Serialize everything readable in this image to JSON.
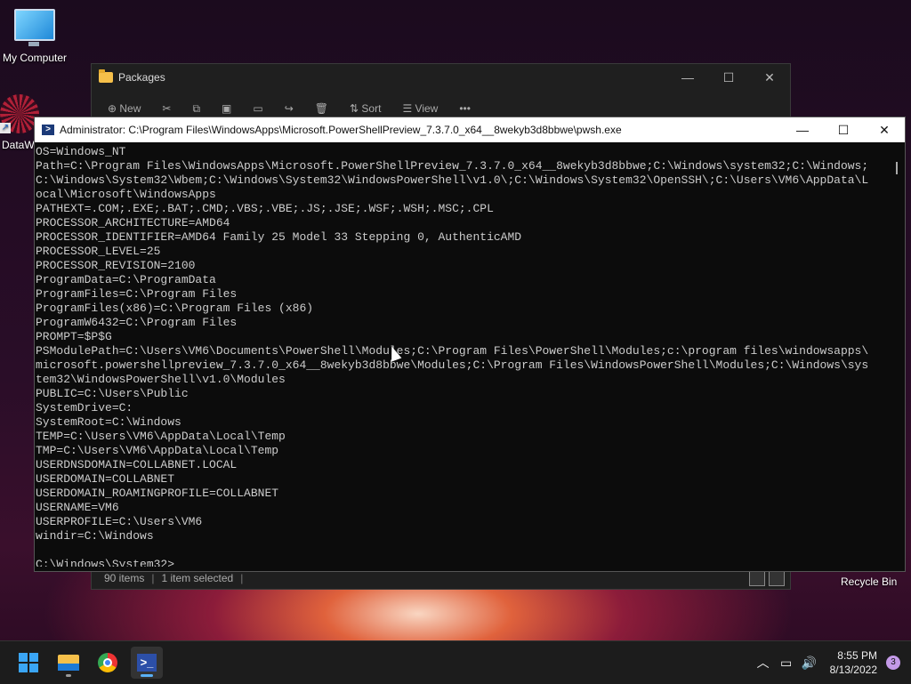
{
  "desktop": {
    "my_computer_label": "My Computer",
    "datawrapper_label": "DataW",
    "recycle_bin_label": "Recycle Bin"
  },
  "explorer": {
    "title": "Packages",
    "toolbar": {
      "new": "New",
      "sort": "Sort",
      "view": "View",
      "more": "•••"
    },
    "status_items": "90 items",
    "status_selected": "1 item selected",
    "controls": {
      "minimize": "—",
      "maximize": "☐",
      "close": "✕"
    }
  },
  "terminal": {
    "title": "Administrator: C:\\Program Files\\WindowsApps\\Microsoft.PowerShellPreview_7.3.7.0_x64__8wekyb3d8bbwe\\pwsh.exe",
    "controls": {
      "minimize": "—",
      "maximize": "☐",
      "close": "✕"
    },
    "lines": [
      "OS=Windows_NT",
      "Path=C:\\Program Files\\WindowsApps\\Microsoft.PowerShellPreview_7.3.7.0_x64__8wekyb3d8bbwe;C:\\Windows\\system32;C:\\Windows;",
      "C:\\Windows\\System32\\Wbem;C:\\Windows\\System32\\WindowsPowerShell\\v1.0\\;C:\\Windows\\System32\\OpenSSH\\;C:\\Users\\VM6\\AppData\\L",
      "ocal\\Microsoft\\WindowsApps",
      "PATHEXT=.COM;.EXE;.BAT;.CMD;.VBS;.VBE;.JS;.JSE;.WSF;.WSH;.MSC;.CPL",
      "PROCESSOR_ARCHITECTURE=AMD64",
      "PROCESSOR_IDENTIFIER=AMD64 Family 25 Model 33 Stepping 0, AuthenticAMD",
      "PROCESSOR_LEVEL=25",
      "PROCESSOR_REVISION=2100",
      "ProgramData=C:\\ProgramData",
      "ProgramFiles=C:\\Program Files",
      "ProgramFiles(x86)=C:\\Program Files (x86)",
      "ProgramW6432=C:\\Program Files",
      "PROMPT=$P$G",
      "PSModulePath=C:\\Users\\VM6\\Documents\\PowerShell\\Modules;C:\\Program Files\\PowerShell\\Modules;c:\\program files\\windowsapps\\",
      "microsoft.powershellpreview_7.3.7.0_x64__8wekyb3d8bbwe\\Modules;C:\\Program Files\\WindowsPowerShell\\Modules;C:\\Windows\\sys",
      "tem32\\WindowsPowerShell\\v1.0\\Modules",
      "PUBLIC=C:\\Users\\Public",
      "SystemDrive=C:",
      "SystemRoot=C:\\Windows",
      "TEMP=C:\\Users\\VM6\\AppData\\Local\\Temp",
      "TMP=C:\\Users\\VM6\\AppData\\Local\\Temp",
      "USERDNSDOMAIN=COLLABNET.LOCAL",
      "USERDOMAIN=COLLABNET",
      "USERDOMAIN_ROAMINGPROFILE=COLLABNET",
      "USERNAME=VM6",
      "USERPROFILE=C:\\Users\\VM6",
      "windir=C:\\Windows",
      ""
    ],
    "prompt": "C:\\Windows\\System32>"
  },
  "taskbar": {
    "time": "8:55 PM",
    "date": "8/13/2022",
    "notification_count": "3",
    "tray_icons": [
      "chevron-up-icon",
      "network-icon",
      "volume-icon"
    ]
  },
  "colors": {
    "terminal_bg": "#0c0c0c",
    "terminal_fg": "#cccccc",
    "taskbar_bg": "#1c1c1c",
    "accent": "#3aa5f5"
  }
}
